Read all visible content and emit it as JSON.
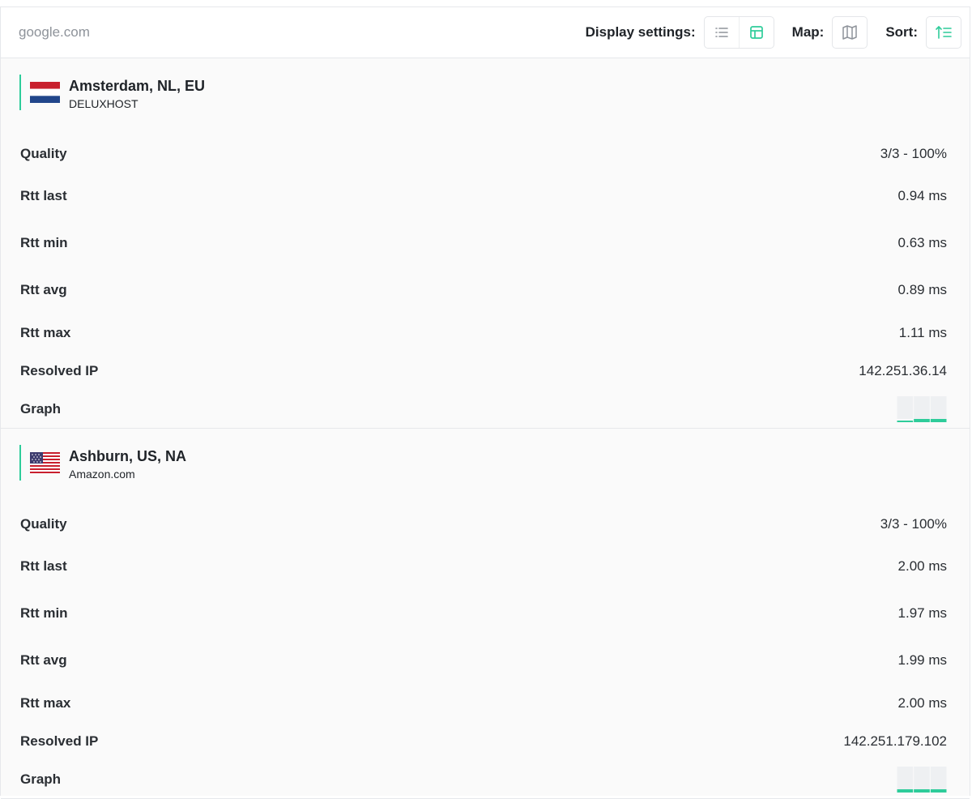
{
  "header": {
    "host": "google.com",
    "display_settings_label": "Display settings:",
    "map_label": "Map:",
    "sort_label": "Sort:"
  },
  "colors": {
    "accent": "#2ecc9a",
    "icon_gray": "#8e939a"
  },
  "icons": {
    "list": "list-icon",
    "table": "table-icon",
    "map": "map-icon",
    "sort": "sort-icon"
  },
  "locations": [
    {
      "name": "Amsterdam, NL, EU",
      "isp": "DELUXHOST",
      "flag": "netherlands-flag-icon",
      "rows": [
        {
          "label": "Quality",
          "value": "3/3 - 100%"
        },
        {
          "label": "Rtt last",
          "value": "0.94 ms"
        },
        {
          "label": "Rtt min",
          "value": "0.63 ms"
        },
        {
          "label": "Rtt avg",
          "value": "0.89 ms"
        },
        {
          "label": "Rtt max",
          "value": "1.11 ms"
        },
        {
          "label": "Resolved IP",
          "value": "142.251.36.14"
        }
      ],
      "graph_label": "Graph",
      "graph_rtts": [
        0.94,
        0.63,
        1.11
      ]
    },
    {
      "name": "Ashburn, US, NA",
      "isp": "Amazon.com",
      "flag": "united-states-flag-icon",
      "rows": [
        {
          "label": "Quality",
          "value": "3/3 - 100%"
        },
        {
          "label": "Rtt last",
          "value": "2.00 ms"
        },
        {
          "label": "Rtt min",
          "value": "1.97 ms"
        },
        {
          "label": "Rtt avg",
          "value": "1.99 ms"
        },
        {
          "label": "Rtt max",
          "value": "2.00 ms"
        },
        {
          "label": "Resolved IP",
          "value": "142.251.179.102"
        }
      ],
      "graph_label": "Graph",
      "graph_rtts": [
        1.97,
        2.0,
        2.0
      ]
    }
  ]
}
